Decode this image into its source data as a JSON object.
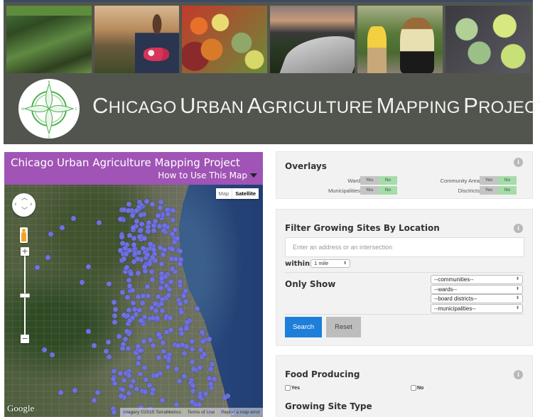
{
  "banner": {
    "title_words": [
      {
        "cap": "C",
        "rest": "HICAGO"
      },
      {
        "cap": "U",
        "rest": "RBAN"
      },
      {
        "cap": "A",
        "rest": "GRICULTURE"
      },
      {
        "cap": "M",
        "rest": "APPING"
      },
      {
        "cap": "P",
        "rest": "ROJECT"
      }
    ],
    "photos": [
      "garden-bed",
      "young-man-with-radishes",
      "vegetables",
      "hoop-house-skyline",
      "mother-and-child-gardening",
      "seedlings"
    ],
    "logo_compass": {
      "n": "N",
      "e": "E",
      "s": "S",
      "w": "W"
    },
    "accent": "#52554e"
  },
  "map": {
    "header_title": "Chicago Urban Agriculture Mapping Project",
    "how_to_label": "How to Use This Map",
    "header_color": "#a054b5",
    "maptype": {
      "map": "Map",
      "satellite": "Satellite",
      "selected": "Satellite"
    },
    "zoom_in": "+",
    "zoom_out": "−",
    "google_logo": "Google",
    "attribution": {
      "imagery": "Imagery ©2015 TerraMetrics",
      "terms": "Terms of Use",
      "report": "Report a map error"
    },
    "marker_color": "#6f72dc"
  },
  "overlays": {
    "title": "Overlays",
    "yes_label": "Yes",
    "no_label": "No",
    "items": [
      {
        "label": "Ward",
        "value": "No"
      },
      {
        "label": "Community Area",
        "value": "No"
      },
      {
        "label": "Municipalities",
        "value": "No"
      },
      {
        "label": "Disctricts",
        "value": "No"
      }
    ]
  },
  "filter": {
    "title": "Filter Growing Sites By Location",
    "address_placeholder": "Enter an address or an intersection",
    "within_label": "within",
    "radius_value": "1 mile",
    "only_show_label": "Only Show",
    "selects": [
      "--communities--",
      "--wards--",
      "--board districts--",
      "--municipalities--"
    ],
    "search_label": "Search",
    "reset_label": "Reset",
    "search_color": "#1d7fd9"
  },
  "food": {
    "title": "Food Producing",
    "options": [
      {
        "label": "Yes",
        "checked": false
      },
      {
        "label": "No",
        "checked": false
      }
    ],
    "next_section_title": "Growing Site Type"
  }
}
